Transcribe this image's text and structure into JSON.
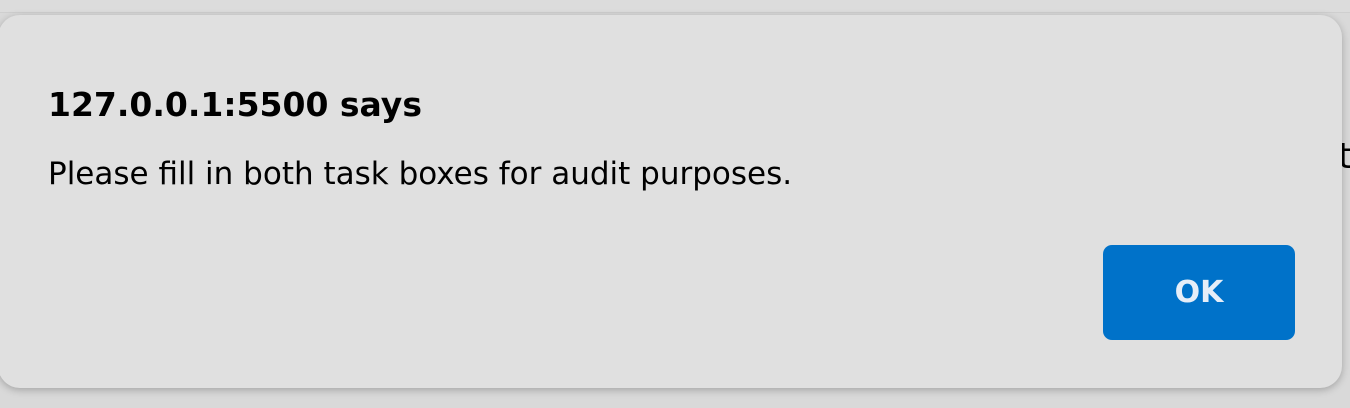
{
  "background": {
    "partial_text": "t"
  },
  "dialog": {
    "title": "127.0.0.1:5500 says",
    "message": "Please fill in both task boxes for audit purposes.",
    "ok_label": "OK",
    "accent_color": "#0072c9"
  }
}
